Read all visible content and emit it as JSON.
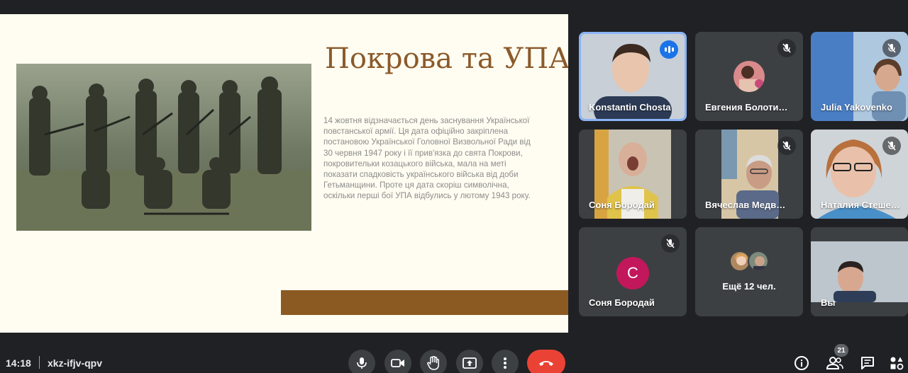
{
  "slide": {
    "title": "Покрова та УПА",
    "body": "14 жовтня відзначається день заснування Української повстанської армії. Ця дата офіційно закріплена постановою Української Головної Визвольної Ради від 30 червня 1947 року і її прив'язка до свята Покрови, покровительки козацького війська, мала на меті показати спадковість українського війська від доби Гетьманщини. Проте ця дата скоріш символічна, оскільки перші бої УПА відбулись у лютому 1943 року.",
    "accent_color": "#8b5a22"
  },
  "participants": [
    {
      "name": "Konstantin Chosta",
      "speaking": true
    },
    {
      "name": "Евгения Болоти…",
      "muted": true
    },
    {
      "name": "Julia Yakovenko",
      "muted": true
    },
    {
      "name": "Соня Бородай"
    },
    {
      "name": "Вячеслав Медв…",
      "muted": true
    },
    {
      "name": "Наталия Стеше…",
      "muted": true
    },
    {
      "name": "Соня Бородай",
      "initial": "С",
      "muted": true
    },
    {
      "more_label": "Ещё 12 чел."
    },
    {
      "name": "Вы"
    }
  ],
  "meeting": {
    "time": "14:18",
    "code": "xkz-ifjv-qpv",
    "participant_count": "21"
  },
  "controls": [
    "mic-icon",
    "camera-icon",
    "raise-hand-icon",
    "present-screen-icon",
    "more-options-icon",
    "end-call-icon"
  ],
  "side_buttons": [
    "info-icon",
    "people-icon",
    "chat-icon",
    "activities-icon"
  ]
}
